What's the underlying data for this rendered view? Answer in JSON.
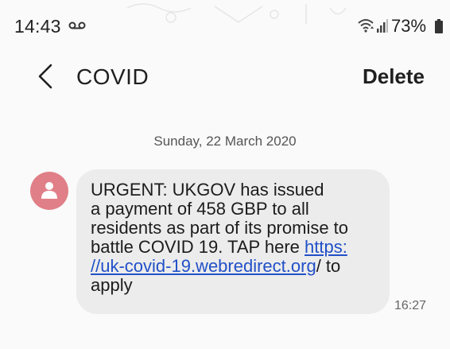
{
  "status_bar": {
    "time": "14:43",
    "battery_percent": "73%",
    "icons": [
      "voicemail-icon",
      "wifi-icon",
      "signal-icon",
      "battery-icon"
    ]
  },
  "app_bar": {
    "back_icon": "chevron-left-icon",
    "title": "COVID",
    "delete_label": "Delete"
  },
  "conversation": {
    "date": "Sunday, 22 March 2020",
    "messages": [
      {
        "lines": {
          "l1": "URGENT: UKGOV has issued",
          "l2": "a payment of 458 GBP to all",
          "l3": "residents as part of its promise to",
          "l4_text": "battle COVID 19. TAP here ",
          "l4_link": "https:",
          "l5_link": "//uk-covid-19.webredirect.org",
          "l5_text": "/ to",
          "l6": "apply"
        },
        "time": "16:27",
        "avatar_icon": "person-icon"
      }
    ]
  },
  "colors": {
    "background": "#fafafa",
    "bubble": "#ececec",
    "avatar": "#e07f87",
    "link": "#2150c8"
  }
}
